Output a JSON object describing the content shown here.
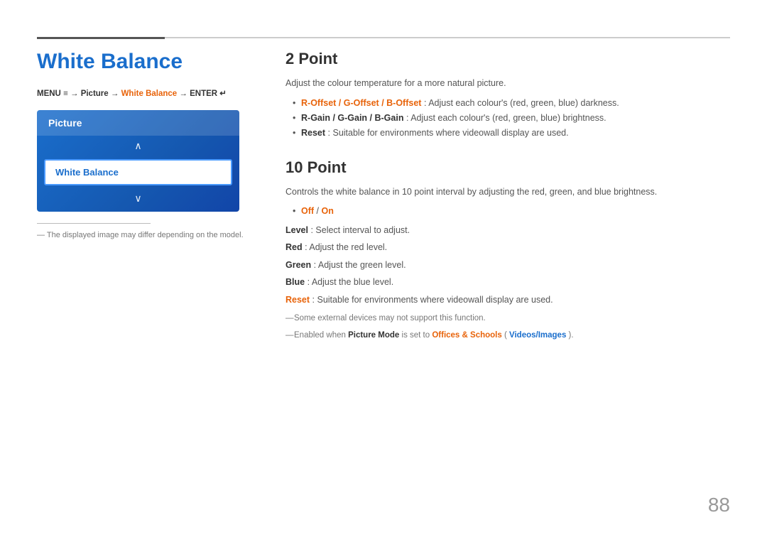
{
  "page": {
    "title": "White Balance",
    "page_number": "88",
    "top_line": true
  },
  "menu_path": {
    "prefix": "MENU",
    "menu_icon": "≡",
    "arrow1": "→",
    "item1": "Picture",
    "arrow2": "→",
    "item2": "White Balance",
    "arrow3": "→",
    "item3": "ENTER",
    "enter_icon": "↵"
  },
  "tv_menu": {
    "header": "Picture",
    "arrow_up": "∧",
    "selected_item": "White Balance",
    "arrow_down": "∨"
  },
  "left_note": "The displayed image may differ depending on the model.",
  "section_2point": {
    "title": "2 Point",
    "description": "Adjust the colour temperature for a more natural picture.",
    "bullets": [
      {
        "bold": "R-Offset / G-Offset / B-Offset",
        "bold_style": "orange",
        "text": ": Adjust each colour's (red, green, blue) darkness."
      },
      {
        "bold": "R-Gain / G-Gain / B-Gain",
        "bold_style": "plain",
        "text": ": Adjust each colour's (red, green, blue) brightness."
      },
      {
        "bold": "Reset",
        "bold_style": "plain",
        "text": ": Suitable for environments where videowall display are used."
      }
    ]
  },
  "section_10point": {
    "title": "10 Point",
    "description": "Controls the white balance in 10 point interval by adjusting the red, green, and blue brightness.",
    "off_on_bullet": {
      "bold": "Off",
      "bold_style": "orange",
      "separator": " / ",
      "bold2": "On",
      "bold2_style": "orange"
    },
    "detail_lines": [
      {
        "bold": "Level",
        "bold_style": "plain",
        "text": ": Select interval to adjust."
      },
      {
        "bold": "Red",
        "bold_style": "plain",
        "text": ": Adjust the red level."
      },
      {
        "bold": "Green",
        "bold_style": "plain",
        "text": ": Adjust the green level."
      },
      {
        "bold": "Blue",
        "bold_style": "plain",
        "text": ": Adjust the blue level."
      },
      {
        "bold": "Reset",
        "bold_style": "orange",
        "text": ": Suitable for environments where videowall display are used."
      }
    ],
    "notes": [
      "Some external devices may not support this function.",
      {
        "prefix": "Enabled when ",
        "bold": "Picture Mode",
        "bold_style": "plain",
        "middle": " is set to ",
        "bold2": "Offices & Schools",
        "bold2_style": "orange",
        "space": " (",
        "bold3": "Videos/Images",
        "bold3_style": "blue",
        "suffix": ")."
      }
    ]
  }
}
